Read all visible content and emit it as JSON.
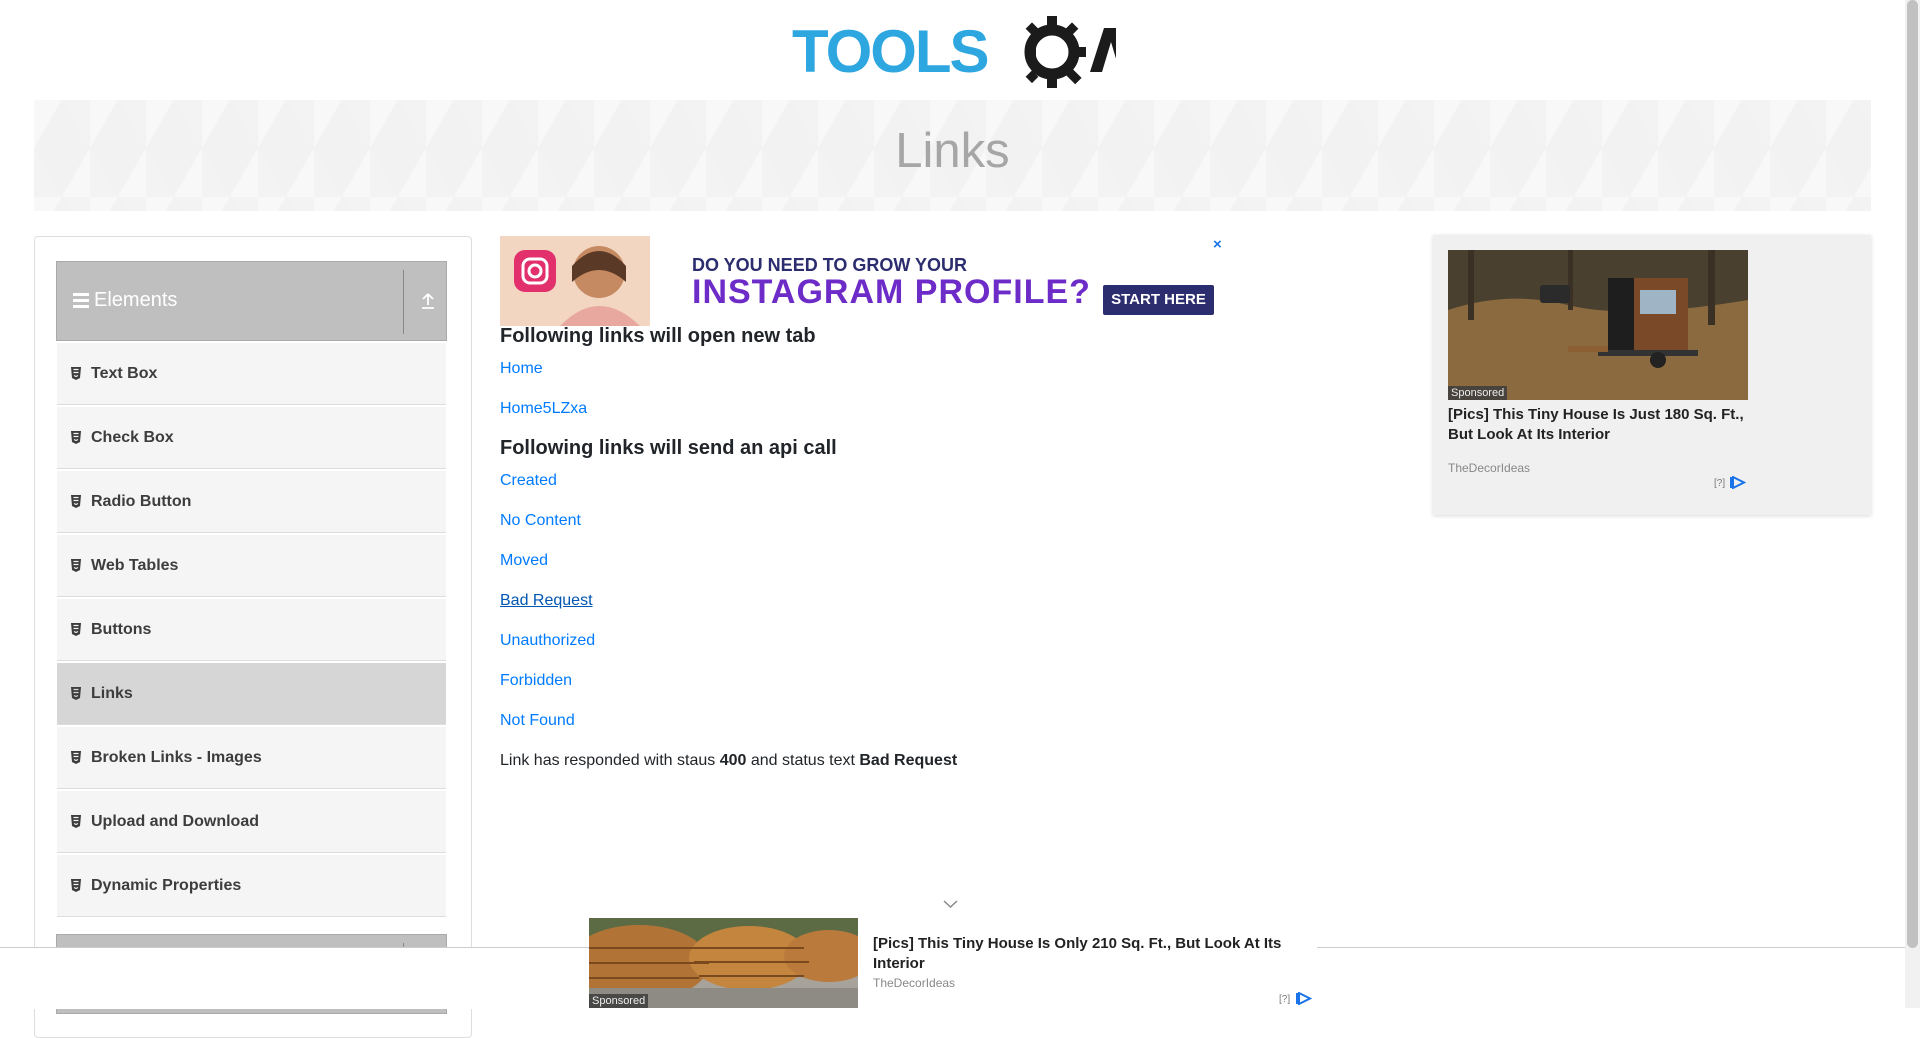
{
  "header": {
    "logo_text": "TOOLSQA",
    "page_title": "Links"
  },
  "sidebar": {
    "group_title": "Elements",
    "items": [
      {
        "label": "Text Box"
      },
      {
        "label": "Check Box"
      },
      {
        "label": "Radio Button"
      },
      {
        "label": "Web Tables"
      },
      {
        "label": "Buttons"
      },
      {
        "label": "Links",
        "active": true
      },
      {
        "label": "Broken Links - Images"
      },
      {
        "label": "Upload and Download"
      },
      {
        "label": "Dynamic Properties"
      }
    ]
  },
  "top_ad": {
    "headline_line1": "DO YOU NEED TO GROW YOUR",
    "headline_line2": "INSTAGRAM PROFILE?",
    "cta": "START HERE",
    "close": "×"
  },
  "main": {
    "new_tab_heading": "Following links will open new tab",
    "new_tab_links": [
      "Home",
      "Home5LZxa"
    ],
    "api_heading": "Following links will send an api call",
    "api_links": [
      "Created",
      "No Content",
      "Moved",
      "Bad Request",
      "Unauthorized",
      "Forbidden",
      "Not Found"
    ],
    "response": {
      "prefix": "Link has responded with staus",
      "status_code": "400",
      "middle": "and status text",
      "status_text": "Bad Request"
    }
  },
  "right_ad": {
    "sponsored": "Sponsored",
    "headline": "[Pics] This Tiny House Is Just 180 Sq. Ft., But Look At Its Interior",
    "source": "TheDecorIdeas",
    "choice": "[?]"
  },
  "bottom_ad": {
    "sponsored": "Sponsored",
    "headline": "[Pics] This Tiny House Is Only 210 Sq. Ft., But Look At Its Interior",
    "source": "TheDecorIdeas",
    "choice": "[?]"
  },
  "colors": {
    "link": "#007bff",
    "logo_blue": "#2ea7e0",
    "logo_dark": "#1b1b1b",
    "sidebar_header": "#bfbfbf",
    "active_item": "#d6d6d6"
  }
}
